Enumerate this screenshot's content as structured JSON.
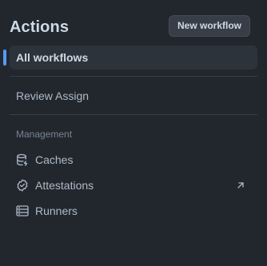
{
  "header": {
    "title": "Actions",
    "new_workflow_label": "New workflow"
  },
  "nav": {
    "all_workflows": "All workflows",
    "review_assign": "Review Assign"
  },
  "management": {
    "section_title": "Management",
    "items": [
      {
        "label": "Caches",
        "icon": "database-icon"
      },
      {
        "label": "Attestations",
        "icon": "verified-check-icon",
        "external": true
      },
      {
        "label": "Runners",
        "icon": "server-icon"
      }
    ]
  },
  "colors": {
    "background": "#22272e",
    "active_item_bg": "#2d333b",
    "accent": "#539bf5",
    "button_bg": "#373e47"
  }
}
